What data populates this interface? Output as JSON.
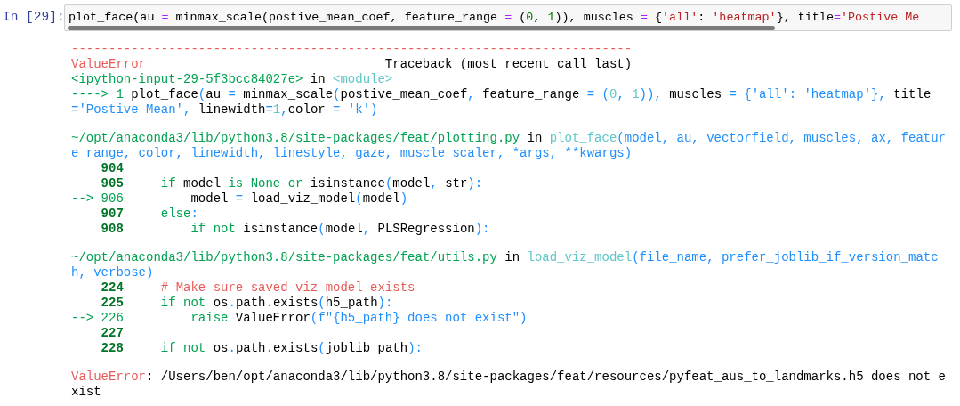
{
  "cell": {
    "prompt": "In [29]:",
    "input": [
      {
        "kind": "plain",
        "text": "plot_face(au "
      },
      {
        "kind": "op",
        "text": "="
      },
      {
        "kind": "plain",
        "text": " minmax_scale(postive_mean_coef, feature_range "
      },
      {
        "kind": "op",
        "text": "="
      },
      {
        "kind": "plain",
        "text": " ("
      },
      {
        "kind": "num",
        "text": "0"
      },
      {
        "kind": "plain",
        "text": ", "
      },
      {
        "kind": "num",
        "text": "1"
      },
      {
        "kind": "plain",
        "text": ")), muscles "
      },
      {
        "kind": "op",
        "text": "="
      },
      {
        "kind": "plain",
        "text": " {"
      },
      {
        "kind": "str",
        "text": "'all'"
      },
      {
        "kind": "plain",
        "text": ": "
      },
      {
        "kind": "str",
        "text": "'heatmap'"
      },
      {
        "kind": "plain",
        "text": "}, title"
      },
      {
        "kind": "op",
        "text": "="
      },
      {
        "kind": "str",
        "text": "'Postive Me"
      }
    ],
    "output": [
      {
        "segments": [
          {
            "kind": "error",
            "text": "---------------------------------------------------------------------------"
          }
        ]
      },
      {
        "segments": [
          {
            "kind": "error",
            "text": "ValueError"
          },
          {
            "kind": "plain",
            "text": "                                Traceback (most recent call last)"
          }
        ]
      },
      {
        "segments": [
          {
            "kind": "path",
            "text": "<ipython-input-29-5f3bcc84027e>"
          },
          {
            "kind": "plain",
            "text": " in "
          },
          {
            "kind": "func",
            "text": "<module>"
          }
        ]
      },
      {
        "segments": [
          {
            "kind": "path",
            "text": "----> 1 "
          },
          {
            "kind": "plain",
            "text": "plot_face"
          },
          {
            "kind": "punct",
            "text": "("
          },
          {
            "kind": "plain",
            "text": "au "
          },
          {
            "kind": "punct",
            "text": "="
          },
          {
            "kind": "plain",
            "text": " minmax_scale"
          },
          {
            "kind": "punct",
            "text": "("
          },
          {
            "kind": "plain",
            "text": "postive_mean_coef"
          },
          {
            "kind": "punct",
            "text": ", "
          },
          {
            "kind": "plain",
            "text": "feature_range "
          },
          {
            "kind": "punct",
            "text": "= ("
          },
          {
            "kind": "func",
            "text": "0"
          },
          {
            "kind": "punct",
            "text": ", "
          },
          {
            "kind": "func",
            "text": "1"
          },
          {
            "kind": "punct",
            "text": ")), "
          },
          {
            "kind": "plain",
            "text": "muscles "
          },
          {
            "kind": "punct",
            "text": "= {'all': 'heatmap'}, "
          },
          {
            "kind": "plain",
            "text": "title"
          }
        ]
      },
      {
        "segments": [
          {
            "kind": "punct",
            "text": "='Postive Mean', "
          },
          {
            "kind": "plain",
            "text": "linewidth"
          },
          {
            "kind": "punct",
            "text": "="
          },
          {
            "kind": "func",
            "text": "1"
          },
          {
            "kind": "punct",
            "text": ","
          },
          {
            "kind": "plain",
            "text": "color "
          },
          {
            "kind": "punct",
            "text": "= 'k')"
          }
        ]
      },
      {
        "blank_before": true,
        "segments": [
          {
            "kind": "path",
            "text": "~/opt/anaconda3/lib/python3.8/site-packages/feat/plotting.py"
          },
          {
            "kind": "plain",
            "text": " in "
          },
          {
            "kind": "func",
            "text": "plot_face"
          },
          {
            "kind": "punct",
            "text": "(model, au, vectorfield, muscles, ax, featur"
          }
        ]
      },
      {
        "segments": [
          {
            "kind": "punct",
            "text": "e_range, color, linewidth, linestyle, gaze, muscle_scaler, *args, **kwargs)"
          }
        ]
      },
      {
        "segments": [
          {
            "kind": "lineno",
            "text": "    904"
          }
        ]
      },
      {
        "segments": [
          {
            "kind": "lineno",
            "text": "    905     "
          },
          {
            "kind": "keyword",
            "text": "if"
          },
          {
            "kind": "plain",
            "text": " model "
          },
          {
            "kind": "keyword",
            "text": "is None or"
          },
          {
            "kind": "plain",
            "text": " isinstance"
          },
          {
            "kind": "punct",
            "text": "("
          },
          {
            "kind": "plain",
            "text": "model"
          },
          {
            "kind": "punct",
            "text": ", "
          },
          {
            "kind": "plain",
            "text": "str"
          },
          {
            "kind": "punct",
            "text": "):"
          }
        ]
      },
      {
        "segments": [
          {
            "kind": "path",
            "text": "--> 906         "
          },
          {
            "kind": "plain",
            "text": "model "
          },
          {
            "kind": "punct",
            "text": "="
          },
          {
            "kind": "plain",
            "text": " load_viz_model"
          },
          {
            "kind": "punct",
            "text": "("
          },
          {
            "kind": "plain",
            "text": "model"
          },
          {
            "kind": "punct",
            "text": ")"
          }
        ]
      },
      {
        "segments": [
          {
            "kind": "lineno",
            "text": "    907     "
          },
          {
            "kind": "keyword",
            "text": "else"
          },
          {
            "kind": "punct",
            "text": ":"
          }
        ]
      },
      {
        "segments": [
          {
            "kind": "lineno",
            "text": "    908         "
          },
          {
            "kind": "keyword",
            "text": "if not"
          },
          {
            "kind": "plain",
            "text": " isinstance"
          },
          {
            "kind": "punct",
            "text": "("
          },
          {
            "kind": "plain",
            "text": "model"
          },
          {
            "kind": "punct",
            "text": ", "
          },
          {
            "kind": "plain",
            "text": "PLSRegression"
          },
          {
            "kind": "punct",
            "text": "):"
          }
        ]
      },
      {
        "blank_before": true,
        "segments": [
          {
            "kind": "path",
            "text": "~/opt/anaconda3/lib/python3.8/site-packages/feat/utils.py"
          },
          {
            "kind": "plain",
            "text": " in "
          },
          {
            "kind": "func",
            "text": "load_viz_model"
          },
          {
            "kind": "punct",
            "text": "(file_name, prefer_joblib_if_version_matc"
          }
        ]
      },
      {
        "segments": [
          {
            "kind": "punct",
            "text": "h, verbose)"
          }
        ]
      },
      {
        "segments": [
          {
            "kind": "lineno",
            "text": "    224     "
          },
          {
            "kind": "error",
            "text": "# Make sure saved viz model exists"
          }
        ]
      },
      {
        "segments": [
          {
            "kind": "lineno",
            "text": "    225     "
          },
          {
            "kind": "keyword",
            "text": "if not"
          },
          {
            "kind": "plain",
            "text": " os"
          },
          {
            "kind": "punct",
            "text": "."
          },
          {
            "kind": "plain",
            "text": "path"
          },
          {
            "kind": "punct",
            "text": "."
          },
          {
            "kind": "plain",
            "text": "exists"
          },
          {
            "kind": "punct",
            "text": "("
          },
          {
            "kind": "plain",
            "text": "h5_path"
          },
          {
            "kind": "punct",
            "text": "):"
          }
        ]
      },
      {
        "segments": [
          {
            "kind": "path",
            "text": "--> 226         "
          },
          {
            "kind": "keyword",
            "text": "raise"
          },
          {
            "kind": "plain",
            "text": " ValueError"
          },
          {
            "kind": "punct",
            "text": "(f\"{h5_path} does not exist\")"
          }
        ]
      },
      {
        "segments": [
          {
            "kind": "lineno",
            "text": "    227"
          }
        ]
      },
      {
        "segments": [
          {
            "kind": "lineno",
            "text": "    228     "
          },
          {
            "kind": "keyword",
            "text": "if not"
          },
          {
            "kind": "plain",
            "text": " os"
          },
          {
            "kind": "punct",
            "text": "."
          },
          {
            "kind": "plain",
            "text": "path"
          },
          {
            "kind": "punct",
            "text": "."
          },
          {
            "kind": "plain",
            "text": "exists"
          },
          {
            "kind": "punct",
            "text": "("
          },
          {
            "kind": "plain",
            "text": "joblib_path"
          },
          {
            "kind": "punct",
            "text": "):"
          }
        ]
      },
      {
        "blank_before": true,
        "segments": [
          {
            "kind": "error",
            "text": "ValueError"
          },
          {
            "kind": "plain",
            "text": ": /Users/ben/opt/anaconda3/lib/python3.8/site-packages/feat/resources/pyfeat_aus_to_landmarks.h5 does not e"
          }
        ]
      },
      {
        "segments": [
          {
            "kind": "plain",
            "text": "xist"
          }
        ]
      }
    ]
  }
}
